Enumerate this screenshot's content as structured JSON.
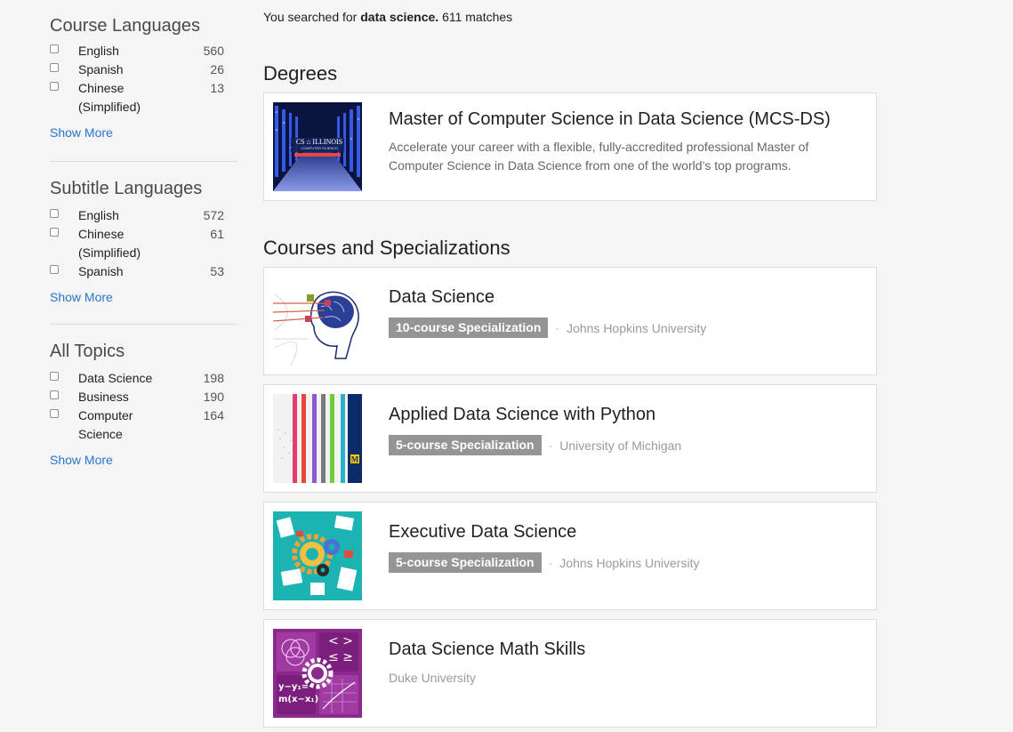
{
  "sidebar": {
    "course_languages": {
      "title": "Course Languages",
      "options": [
        {
          "label": "English",
          "count": "560"
        },
        {
          "label": "Spanish",
          "count": "26"
        },
        {
          "label": "Chinese (Simplified)",
          "count": "13"
        }
      ],
      "show_more": "Show More"
    },
    "subtitle_languages": {
      "title": "Subtitle Languages",
      "options": [
        {
          "label": "English",
          "count": "572"
        },
        {
          "label": "Chinese (Simplified)",
          "count": "61"
        },
        {
          "label": "Spanish",
          "count": "53"
        }
      ],
      "show_more": "Show More"
    },
    "all_topics": {
      "title": "All Topics",
      "options": [
        {
          "label": "Data Science",
          "count": "198"
        },
        {
          "label": "Business",
          "count": "190"
        },
        {
          "label": "Computer Science",
          "count": "164"
        }
      ],
      "show_more": "Show More"
    }
  },
  "search": {
    "prefix": "You searched for",
    "query": "data science.",
    "matches": "611 matches"
  },
  "degrees": {
    "title": "Degrees",
    "items": [
      {
        "title": "Master of Computer Science in Data Science (MCS-DS)",
        "description": "Accelerate your career with a flexible, fully-accredited professional Master of Computer Science in Data Science from one of the world’s top programs."
      }
    ]
  },
  "courses": {
    "title": "Courses and Specializations",
    "items": [
      {
        "title": "Data Science",
        "tag": "10-course Specialization",
        "partner": "Johns Hopkins University"
      },
      {
        "title": "Applied Data Science with Python",
        "tag": "5-course Specialization",
        "partner": "University of Michigan"
      },
      {
        "title": "Executive Data Science",
        "tag": "5-course Specialization",
        "partner": "Johns Hopkins University"
      },
      {
        "title": "Data Science Math Skills",
        "partner": "Duke University"
      }
    ]
  },
  "thumb_text": {
    "uiuc": "CS ⌂ ILLINOIS",
    "uiuc_sub": "COMPUTER SCIENCE",
    "math_ops": "< >",
    "math_ops2": "≤ ≥",
    "math_formula1": "y−y₁=",
    "math_formula2": "m(x−x₁)"
  },
  "colors": {
    "link": "#2a73cc",
    "tag_bg": "#959595",
    "umich_yellow": "#ffcb05",
    "math_purple": "#8b2a8c",
    "teal": "#1cb3b3"
  }
}
